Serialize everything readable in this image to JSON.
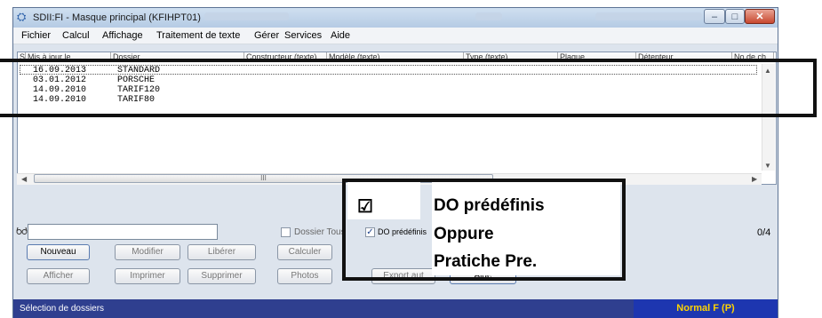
{
  "window": {
    "title": "SDII:FI - Masque principal (KFIHPT01)",
    "controls": {
      "minimize": "–",
      "maximize": "□",
      "close": "✕"
    },
    "app_icon": "app-icon"
  },
  "menu": [
    "Fichier",
    "Calcul",
    "Affichage",
    "Traitement de texte",
    "Gérer",
    "Services",
    "Aide"
  ],
  "table": {
    "columns": [
      "Sî",
      "Mis à jour le",
      "Dossier",
      "Constructeur (texte)",
      "Modèle (texte)",
      "Type (texte)",
      "Plaque",
      "Détenteur",
      "No de ch"
    ],
    "rows": [
      {
        "date": "16.09.2013",
        "dossier": "STANDARD"
      },
      {
        "date": "03.01.2012",
        "dossier": "PORSCHE"
      },
      {
        "date": "14.09.2010",
        "dossier": "TARIF120"
      },
      {
        "date": "14.09.2010",
        "dossier": "TARIF80"
      }
    ],
    "scroll_thumb": "III"
  },
  "controls": {
    "search_icon": "glasses-icon",
    "search_value": "",
    "dossier_tous_label": "Dossier Tous",
    "do_predefinis_label": "DO prédéfinis",
    "do_predefinis_checked": true,
    "count": "0/4",
    "buttons": {
      "nouveau": "Nouveau",
      "modifier": "Modifier",
      "liberer": "Libérer",
      "calculer": "Calculer",
      "afficher": "Afficher",
      "imprimer": "Imprimer",
      "supprimer": "Supprimer",
      "photos": "Photos",
      "export": "Export aut",
      "aide": "Aide"
    }
  },
  "annotation": {
    "checkmark": "☑",
    "line1": "DO prédéfinis",
    "line2": "Oppure",
    "line3": "Pratiche Pre."
  },
  "statusbar": {
    "left": "Sélection de dossiers",
    "right": "Normal F (P)"
  }
}
